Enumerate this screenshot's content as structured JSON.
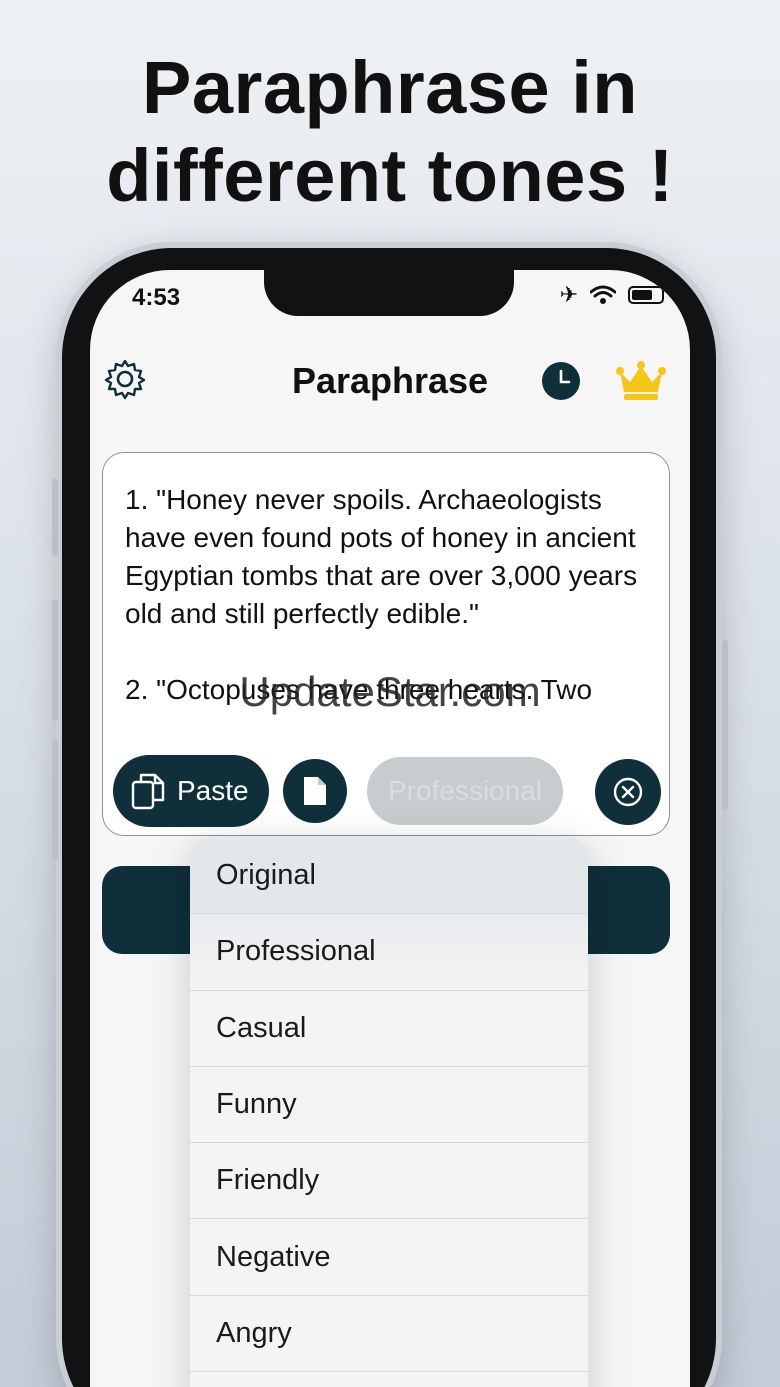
{
  "headline": {
    "line1": "Paraphrase in",
    "line2": "different tones !"
  },
  "status_bar": {
    "time": "4:53",
    "airplane_glyph": "✈",
    "wifi_glyph": "◠"
  },
  "navbar": {
    "title": "Paraphrase"
  },
  "editor": {
    "text": "1. \"Honey never spoils. Archaeologists have even found pots of honey in ancient Egyptian tombs that are over 3,000 years old and still perfectly edible.\"\n\n2. \"Octopuses have three hearts. Two"
  },
  "watermark": "UpdateStar.com",
  "toolbar": {
    "paste_label": "Paste",
    "tone_label": "Professional"
  },
  "tone_menu": {
    "items": [
      "Original",
      "Professional",
      "Casual",
      "Funny",
      "Friendly",
      "Negative",
      "Angry"
    ]
  },
  "colors": {
    "primary": "#0f2f3b",
    "crown": "#f5c518"
  },
  "icons": [
    "gear-icon",
    "history-clock-icon",
    "crown-icon",
    "paste-icon",
    "document-icon",
    "clear-icon"
  ]
}
